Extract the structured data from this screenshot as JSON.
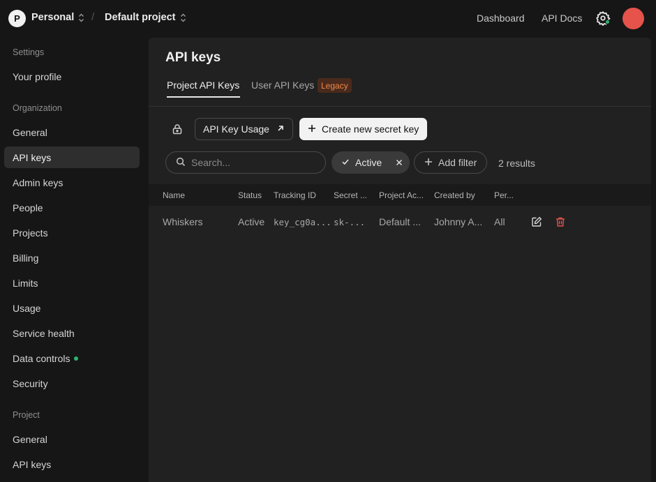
{
  "topbar": {
    "org_initial": "P",
    "org_name": "Personal",
    "project_name": "Default project",
    "separator": "/",
    "links": {
      "dashboard": "Dashboard",
      "api_docs": "API Docs"
    }
  },
  "sidebar": {
    "sections": {
      "settings": "Settings",
      "organization": "Organization",
      "project": "Project"
    },
    "items": {
      "your_profile": "Your profile",
      "general": "General",
      "api_keys": "API keys",
      "admin_keys": "Admin keys",
      "people": "People",
      "projects": "Projects",
      "billing": "Billing",
      "limits": "Limits",
      "usage": "Usage",
      "service_health": "Service health",
      "data_controls": "Data controls",
      "security": "Security",
      "project_general": "General",
      "project_api_keys": "API keys"
    }
  },
  "main": {
    "title": "API keys",
    "tabs": {
      "project": "Project API Keys",
      "user": "User API Keys",
      "legacy_badge": "Legacy"
    },
    "buttons": {
      "usage": "API Key Usage",
      "create": "Create new secret key"
    },
    "filters": {
      "search_placeholder": "Search...",
      "active_chip": "Active",
      "add_filter": "Add filter",
      "results": "2 results"
    },
    "table": {
      "headers": {
        "name": "Name",
        "status": "Status",
        "tracking_id": "Tracking ID",
        "secret": "Secret ...",
        "project_access": "Project Ac...",
        "created_by": "Created by",
        "permissions": "Per..."
      },
      "rows": [
        {
          "name": "Whiskers",
          "status": "Active",
          "tracking_id": "key_cg0a...",
          "secret": "sk-...",
          "project_access": "Default ...",
          "created_by": "Johnny A...",
          "permissions": "All"
        }
      ]
    }
  },
  "colors": {
    "accent_green": "#2ab56f",
    "avatar_red": "#e5534b",
    "danger": "#e5534b",
    "legacy_text": "#ef8a4b"
  }
}
